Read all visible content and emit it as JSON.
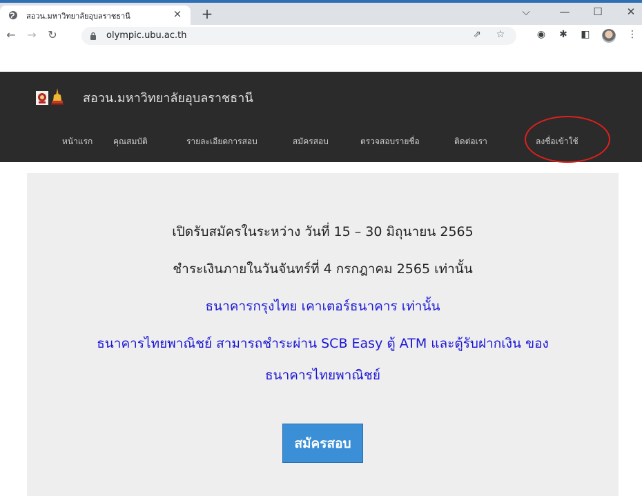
{
  "browser": {
    "tab_title": "สอวน.มหาวิทยาลัยอุบลราชธานี",
    "tab_close": "×",
    "new_tab": "+",
    "url": "olympic.ubu.ac.th",
    "accent_color": "#2f6fb3",
    "icons": [
      "globe-icon",
      "back-icon",
      "forward-icon",
      "reload-icon",
      "lock-icon",
      "share-icon",
      "star-icon",
      "extension-icon",
      "puzzle-icon",
      "sidepanel-icon",
      "avatar",
      "menu-icon",
      "chevron-down-icon",
      "minimize-icon",
      "maximize-icon",
      "close-icon"
    ]
  },
  "site": {
    "brand_name": "สอวน.มหาวิทยาลัยอุบลราชธานี",
    "header_color": "#2b2b2b",
    "nav": [
      "หน้าแรก",
      "คุณสมบัติ",
      "รายละเอียดการสอบ",
      "สมัครสอบ",
      "ตรวจสอบรายชื่อ",
      "ติดต่อเรา",
      "ลงชื่อเข้าใช้"
    ]
  },
  "annotation": {
    "color": "#e0201b",
    "target": "ลงชื่อเข้าใช้"
  },
  "main": {
    "lines": [
      "เปิดรับสมัครในระหว่าง วันที่ 15 – 30 มิถุนายน 2565",
      "ชำระเงินภายในวันจันทร์ที่ 4 กรกฎาคม 2565 เท่านั้น",
      "ธนาคารกรุงไทย เคาเตอร์ธนาคาร เท่านั้น",
      "ธนาคารไทยพาณิชย์ สามารถชำระผ่าน SCB Easy ตู้ ATM และตู้รับฝากเงิน ของ",
      "ธนาคารไทยพาณิชย์"
    ],
    "apply_button": "สมัครสอบ",
    "button_color": "#3b8fd6",
    "link_color": "#1a16d6"
  }
}
